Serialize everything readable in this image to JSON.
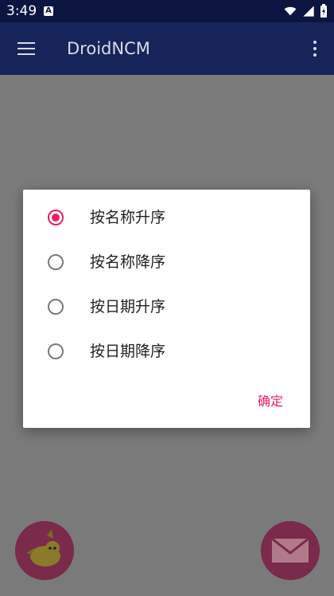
{
  "status_bar": {
    "time": "3:49",
    "notification_icon": "a-box-icon",
    "wifi_icon": "wifi-icon",
    "signal_icon": "signal-icon",
    "battery_icon": "battery-charging-icon"
  },
  "app_bar": {
    "title": "DroidNCM",
    "menu_icon": "hamburger-icon",
    "overflow_icon": "more-vert-icon"
  },
  "dialog": {
    "options": [
      {
        "label": "按名称升序",
        "selected": true
      },
      {
        "label": "按名称降序",
        "selected": false
      },
      {
        "label": "按日期升序",
        "selected": false
      },
      {
        "label": "按日期降序",
        "selected": false
      }
    ],
    "confirm_label": "确定"
  },
  "colors": {
    "primary_dark": "#0b153f",
    "primary": "#17245a",
    "accent": "#e91e63",
    "scrim": "#7a7a7a"
  },
  "fabs": {
    "left_icon": "pikachu-icon",
    "right_icon": "mail-icon"
  }
}
